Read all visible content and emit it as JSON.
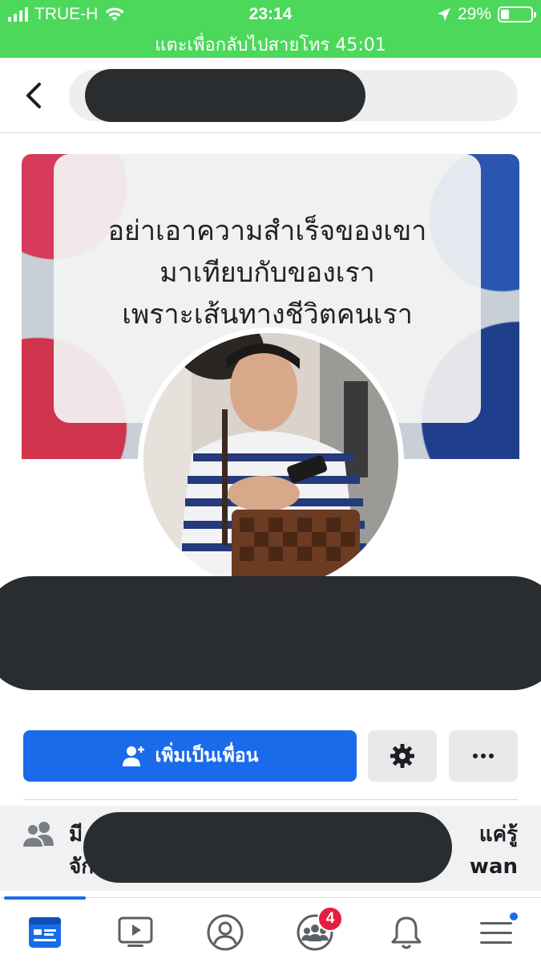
{
  "status_bar": {
    "carrier": "TRUE-H",
    "time": "23:14",
    "battery": "29%",
    "battery_level": 0.29,
    "call_banner": "แตะเพื่อกลับไปสายโทร 45:01"
  },
  "cover": {
    "quote_lines": [
      "อย่าเอาความสำเร็จของเขา",
      "มาเทียบกับของเรา",
      "เพราะเส้นทางชีวิตคนเรา"
    ]
  },
  "actions": {
    "add_friend_label": "เพิ่มเป็นเพื่อน"
  },
  "mutual": {
    "line1_start": "มี",
    "line1_end": "แค่รู้",
    "line2_start": "จัก",
    "line2_end": "wan"
  },
  "nav": {
    "groups_badge": "4"
  },
  "colors": {
    "status_bar": "#4cd85b",
    "accent": "#1a6bea",
    "badge": "#e41e3f",
    "redaction": "#2a2d30"
  },
  "icons": [
    "back-chevron-icon",
    "wifi-icon",
    "location-arrow-icon",
    "battery-icon",
    "add-friend-icon",
    "gear-icon",
    "more-icon",
    "people-icon",
    "news-feed-icon",
    "watch-video-icon",
    "profile-icon",
    "groups-icon",
    "bell-icon",
    "menu-icon"
  ]
}
